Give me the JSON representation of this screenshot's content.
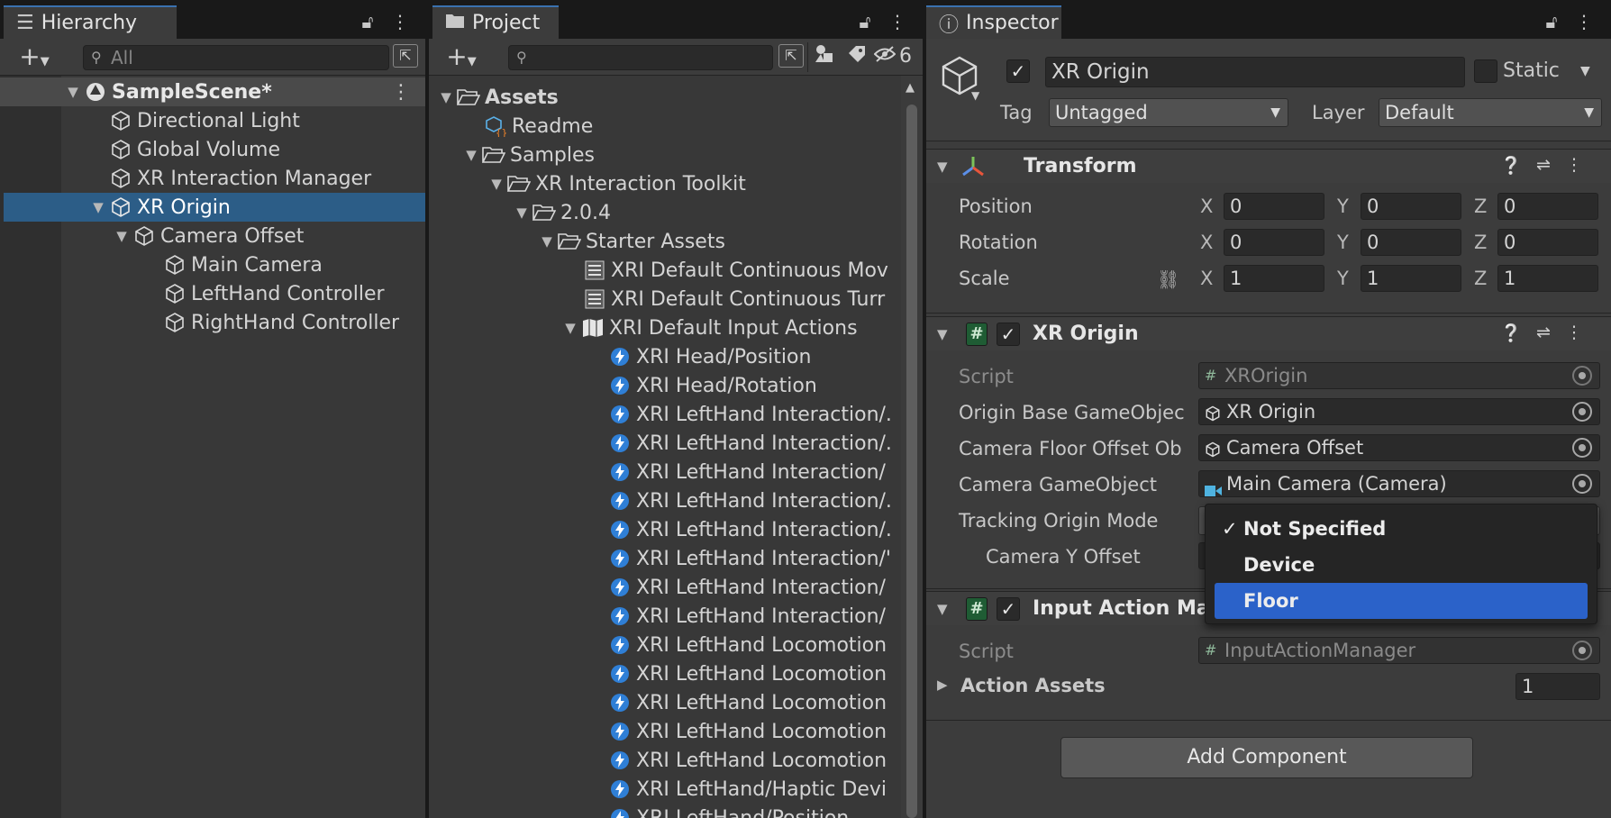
{
  "hierarchy": {
    "tab_label": "Hierarchy",
    "search_placeholder": "All",
    "scene_name": "SampleScene*",
    "items": [
      {
        "label": "Directional Light"
      },
      {
        "label": "Global Volume"
      },
      {
        "label": "XR Interaction Manager"
      },
      {
        "label": "XR Origin"
      },
      {
        "label": "Camera Offset"
      },
      {
        "label": "Main Camera"
      },
      {
        "label": "LeftHand Controller"
      },
      {
        "label": "RightHand Controller"
      }
    ]
  },
  "project": {
    "tab_label": "Project",
    "search_placeholder": "",
    "hidden_count": "6",
    "folders": [
      {
        "label": "Assets"
      },
      {
        "label": "Readme"
      },
      {
        "label": "Samples"
      },
      {
        "label": "XR Interaction Toolkit"
      },
      {
        "label": "2.0.4"
      },
      {
        "label": "Starter Assets"
      }
    ],
    "assets": [
      {
        "label": "XRI Default Continuous Mov"
      },
      {
        "label": "XRI Default Continuous Turr"
      },
      {
        "label": "XRI Default Input Actions"
      }
    ],
    "actions": [
      {
        "label": "XRI Head/Position"
      },
      {
        "label": "XRI Head/Rotation"
      },
      {
        "label": "XRI LeftHand Interaction/."
      },
      {
        "label": "XRI LeftHand Interaction/."
      },
      {
        "label": "XRI LeftHand Interaction/"
      },
      {
        "label": "XRI LeftHand Interaction/."
      },
      {
        "label": "XRI LeftHand Interaction/."
      },
      {
        "label": "XRI LeftHand Interaction/'"
      },
      {
        "label": "XRI LeftHand Interaction/"
      },
      {
        "label": "XRI LeftHand Interaction/"
      },
      {
        "label": "XRI LeftHand Locomotion"
      },
      {
        "label": "XRI LeftHand Locomotion"
      },
      {
        "label": "XRI LeftHand Locomotion"
      },
      {
        "label": "XRI LeftHand Locomotion"
      },
      {
        "label": "XRI LeftHand Locomotion"
      },
      {
        "label": "XRI LeftHand/Haptic Devi"
      },
      {
        "label": "XRI LeftHand/Position"
      }
    ]
  },
  "inspector": {
    "tab_label": "Inspector",
    "object_name": "XR Origin",
    "static_label": "Static",
    "tag_label": "Tag",
    "tag_value": "Untagged",
    "layer_label": "Layer",
    "layer_value": "Default",
    "transform": {
      "title": "Transform",
      "rows": [
        {
          "label": "Position",
          "x": "0",
          "y": "0",
          "z": "0"
        },
        {
          "label": "Rotation",
          "x": "0",
          "y": "0",
          "z": "0"
        },
        {
          "label": "Scale",
          "x": "1",
          "y": "1",
          "z": "1"
        }
      ],
      "axis_x": "X",
      "axis_y": "Y",
      "axis_z": "Z"
    },
    "xr_origin": {
      "title": "XR Origin",
      "script_label": "Script",
      "script_value": "XROrigin",
      "origin_base_label": "Origin Base GameObjec",
      "origin_base_value": "XR Origin",
      "floor_offset_label": "Camera Floor Offset Ob",
      "floor_offset_value": "Camera Offset",
      "camera_go_label": "Camera GameObject",
      "camera_go_value": "Main Camera (Camera)",
      "tracking_mode_label": "Tracking Origin Mode",
      "camera_y_label": "Camera Y Offset"
    },
    "input_action_manager": {
      "title": "Input Action Mar",
      "script_label": "Script",
      "script_value": "InputActionManager",
      "action_assets_label": "Action Assets",
      "action_assets_count": "1"
    },
    "add_component_label": "Add Component"
  },
  "dropdown_popup": {
    "options": [
      {
        "label": "Not Specified",
        "checked": true
      },
      {
        "label": "Device",
        "checked": false
      },
      {
        "label": "Floor",
        "checked": false
      }
    ],
    "highlighted": "Floor"
  },
  "colors": {
    "selection": "#2c5d87",
    "highlight": "#2b62c9",
    "panel": "#383838"
  }
}
